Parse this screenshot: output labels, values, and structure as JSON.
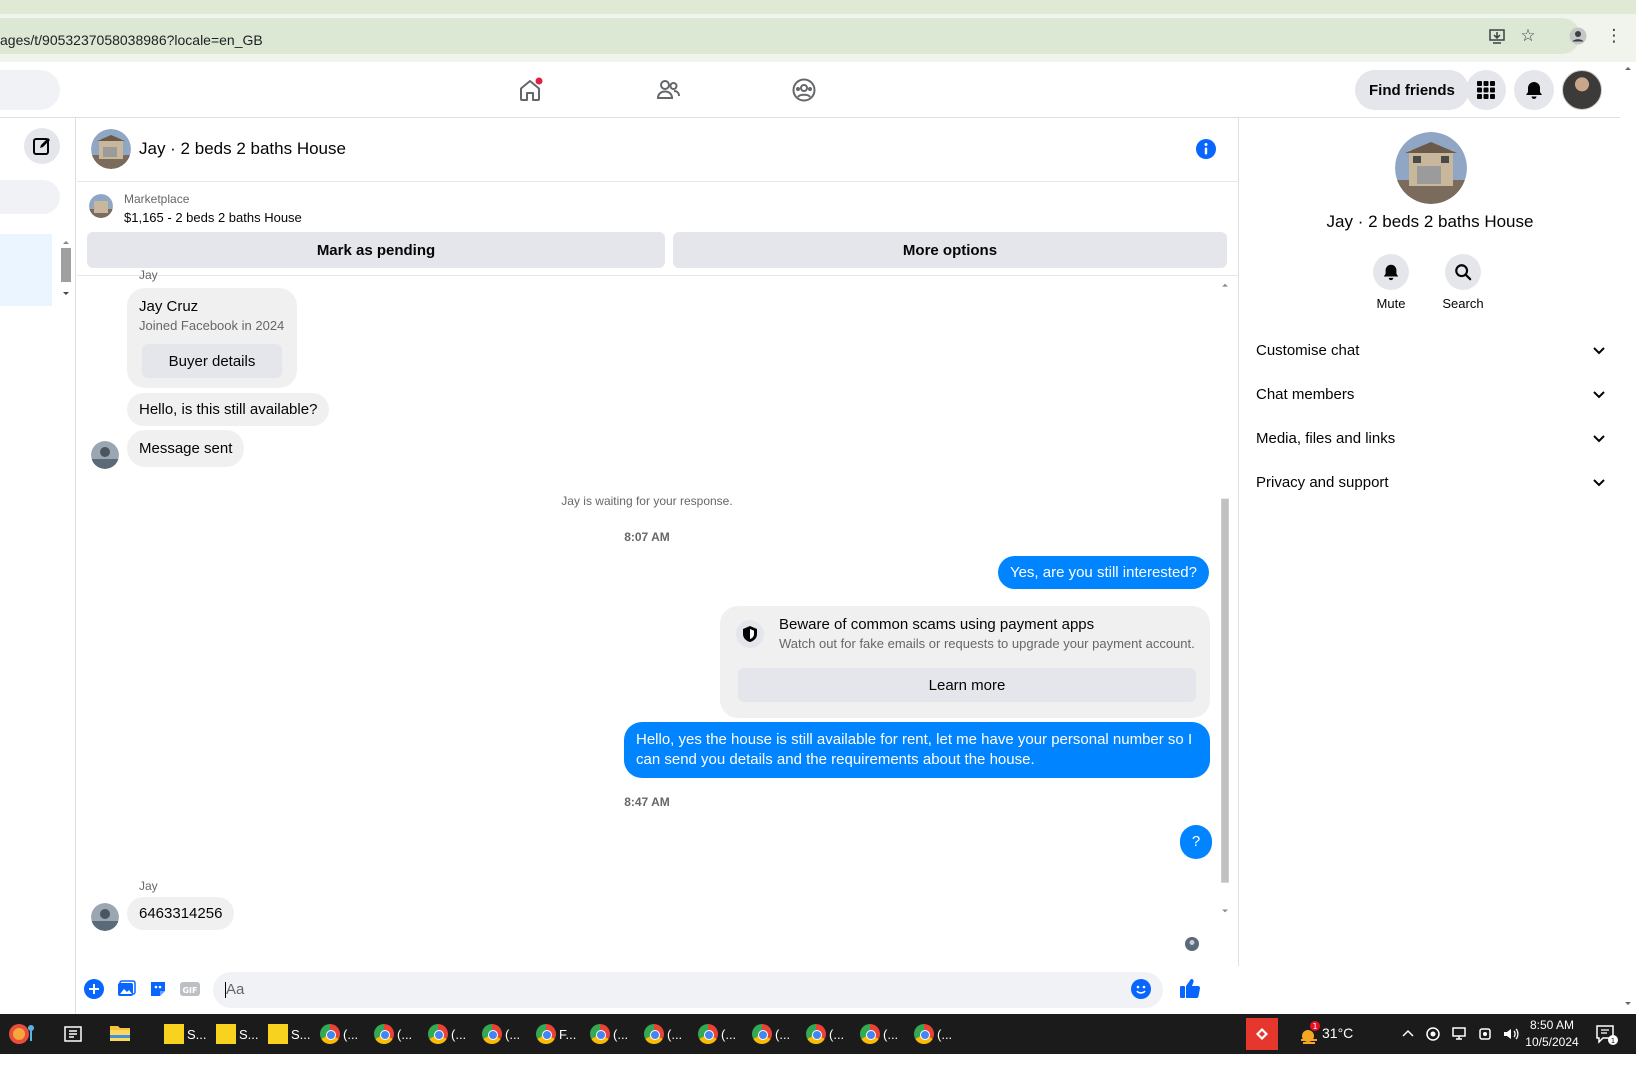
{
  "browser": {
    "url": "ages/t/9053237058038986?locale=en_GB"
  },
  "topbar": {
    "find_friends_label": "Find friends"
  },
  "chat": {
    "title": "Jay · 2 beds 2 baths House",
    "marketplace_label": "Marketplace",
    "listing": "$1,165 - 2 beds 2 baths House",
    "mark_pending_label": "Mark as pending",
    "more_options_label": "More options",
    "sender_top_cut": "Jay",
    "card": {
      "name": "Jay Cruz",
      "joined": "Joined Facebook in 2024",
      "button": "Buyer details"
    },
    "messages": {
      "m1": "Hello, is this still available?",
      "m2": "Message sent",
      "waiting": "Jay is waiting for your response.",
      "time1": "8:07 AM",
      "out1": "Yes, are you still interested?",
      "scam_title": "Beware of common scams using payment apps",
      "scam_body": "Watch out for fake emails or requests to upgrade your payment account.",
      "learn_more": "Learn more",
      "out2": "Hello, yes the house is still available for rent, let me have your personal number so I can send you details and the requirements about the house.",
      "time2": "8:47 AM",
      "out3": "?",
      "sender2": "Jay",
      "in_phone": "6463314256"
    },
    "composer_placeholder": "Aa"
  },
  "right_panel": {
    "title": "Jay · 2 beds 2 baths House",
    "mute_label": "Mute",
    "search_label": "Search",
    "sections": [
      "Customise chat",
      "Chat members",
      "Media, files and links",
      "Privacy and support"
    ]
  },
  "taskbar": {
    "apps": [
      "S...",
      "S...",
      "S...",
      "(...",
      "(...",
      "(...",
      "(...",
      "F...",
      "(...",
      "(...",
      "(...",
      "(...",
      "(...",
      "(...",
      "(..."
    ],
    "weather": "31°C",
    "time": "8:50 AM",
    "date": "10/5/2024",
    "notification_count": "1"
  },
  "colors": {
    "messenger_blue": "#0084ff",
    "bubble_grey": "#f0f0f0",
    "button_grey": "#e4e6eb",
    "fb_blue": "#1877f2"
  },
  "icons": [
    "home-icon",
    "friends-icon",
    "groups-icon",
    "grid-menu-icon",
    "bell-icon",
    "compose-icon",
    "info-icon",
    "shield-icon",
    "plus-icon",
    "image-icon",
    "sticker-icon",
    "gif-icon",
    "emoji-icon",
    "thumbs-up-icon",
    "search-icon",
    "chevron-down-icon"
  ]
}
